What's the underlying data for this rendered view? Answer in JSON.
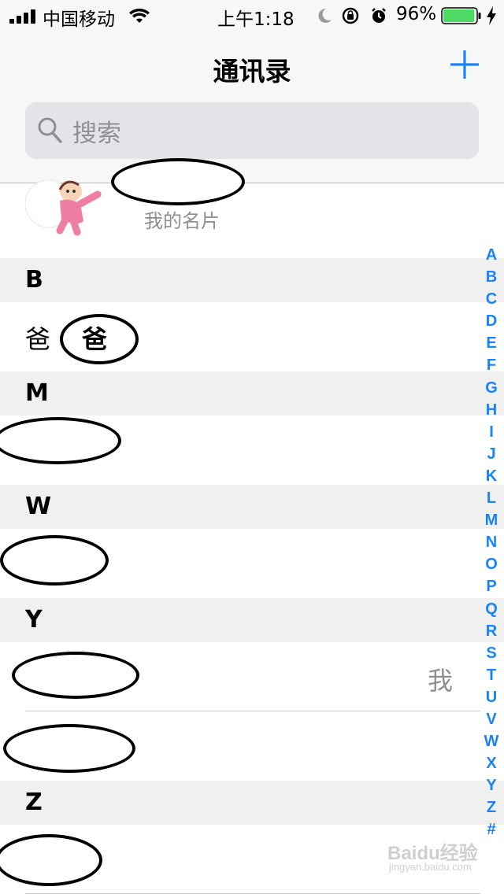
{
  "status_bar": {
    "carrier": "中国移动",
    "time": "上午1:18",
    "battery_percent": "96%",
    "battery_level": 0.96,
    "signal_bars": 4
  },
  "nav": {
    "title": "通讯录",
    "add_icon": "plus-icon"
  },
  "search": {
    "placeholder": "搜索",
    "icon": "search-icon"
  },
  "my_card": {
    "subtitle": "我的名片"
  },
  "sections": {
    "b": {
      "letter": "B",
      "contacts": [
        {
          "name_prefix": "爸",
          "name_suffix": "爸"
        }
      ]
    },
    "m": {
      "letter": "M"
    },
    "w": {
      "letter": "W"
    },
    "y": {
      "letter": "Y",
      "me_label": "我"
    },
    "z": {
      "letter": "Z"
    }
  },
  "index_letters": [
    "A",
    "B",
    "C",
    "D",
    "E",
    "F",
    "G",
    "H",
    "I",
    "J",
    "K",
    "L",
    "M",
    "N",
    "O",
    "P",
    "Q",
    "R",
    "S",
    "T",
    "U",
    "V",
    "W",
    "X",
    "Y",
    "Z",
    "#"
  ],
  "watermark": {
    "main": "Baidu经验",
    "sub": "jingyan.baidu.com"
  },
  "colors": {
    "accent": "#1a82fb",
    "battery": "#4cd964",
    "secondary_text": "#8e8e93"
  }
}
